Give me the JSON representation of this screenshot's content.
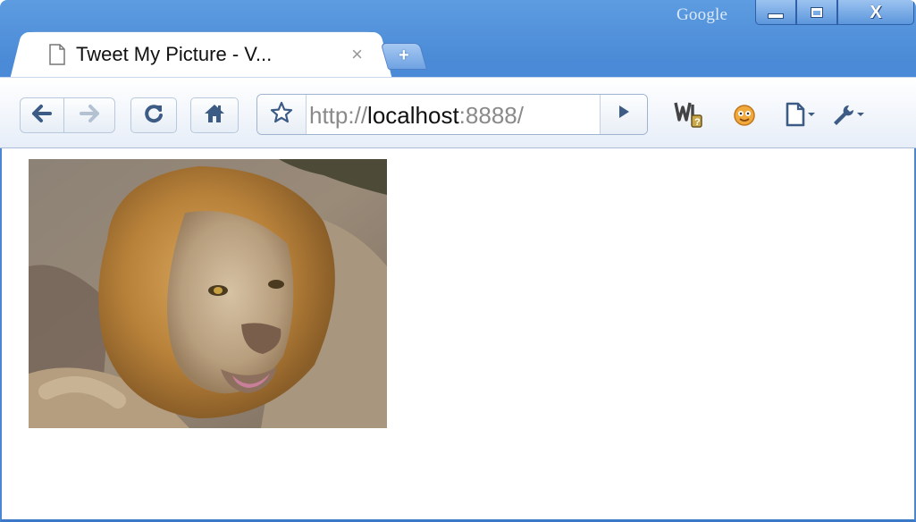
{
  "window": {
    "brand": "Google",
    "minimize_icon": "minimize-icon",
    "maximize_icon": "maximize-icon",
    "close_icon": "close-icon",
    "close_glyph": "X"
  },
  "tab": {
    "title": "Tweet My Picture - V...",
    "close": "×",
    "icon": "page-icon"
  },
  "new_tab": {
    "glyph": "+",
    "icon": "new-tab-icon"
  },
  "toolbar": {
    "back_icon": "back-arrow-icon",
    "forward_icon": "forward-arrow-icon",
    "reload_icon": "reload-icon",
    "home_icon": "home-icon",
    "address": {
      "scheme": "http://",
      "host": "localhost",
      "rest": ":8888/",
      "star_icon": "bookmark-star-icon",
      "go_icon": "go-arrow-icon"
    },
    "extensions": [
      "web-developer-icon",
      "smiley-extension-icon",
      "page-menu-icon",
      "wrench-menu-icon"
    ]
  },
  "content": {
    "image": "lion-photo"
  },
  "colors": {
    "frame": "#4a8ad6",
    "toolbar": "#e7eef8",
    "accent": "#3c5c86"
  }
}
